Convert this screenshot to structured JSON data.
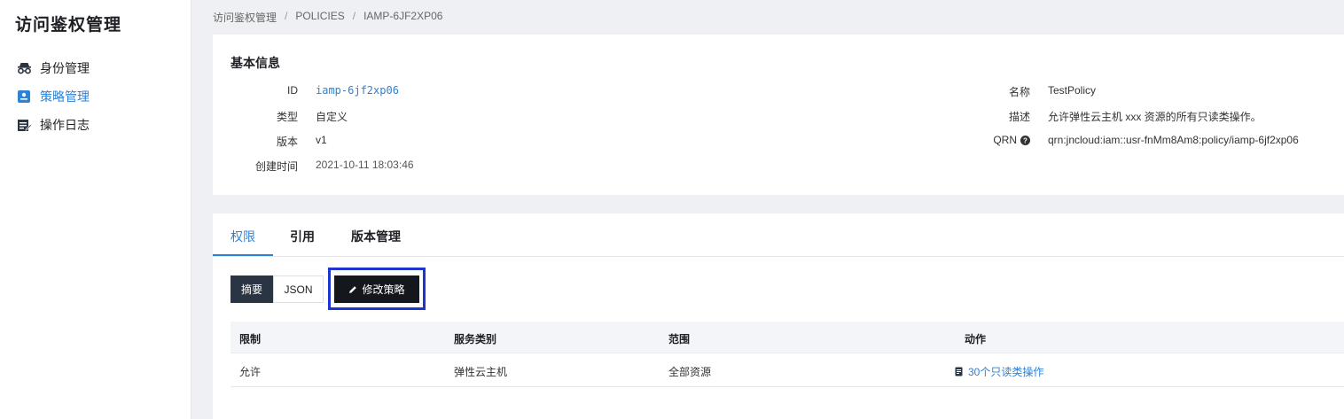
{
  "sidebar": {
    "title": "访问鉴权管理",
    "items": [
      {
        "label": "身份管理",
        "icon": "identity-icon"
      },
      {
        "label": "策略管理",
        "icon": "policy-icon"
      },
      {
        "label": "操作日志",
        "icon": "log-icon"
      }
    ]
  },
  "breadcrumb": [
    "访问鉴权管理",
    "POLICIES",
    "IAMP-6JF2XP06"
  ],
  "basic_info": {
    "title": "基本信息",
    "left": [
      {
        "label": "ID",
        "value": "iamp-6jf2xp06"
      },
      {
        "label": "类型",
        "value": "自定义"
      },
      {
        "label": "版本",
        "value": "v1"
      },
      {
        "label": "创建时间",
        "value": "2021-10-11 18:03:46"
      }
    ],
    "right": [
      {
        "label": "名称",
        "value": "TestPolicy"
      },
      {
        "label": "描述",
        "value": "允许弹性云主机 xxx 资源的所有只读类操作。"
      },
      {
        "label": "QRN",
        "value": "qrn:jncloud:iam::usr-fnMm8Am8:policy/iamp-6jf2xp06"
      }
    ]
  },
  "tabs": [
    "权限",
    "引用",
    "版本管理"
  ],
  "view_toggle": {
    "summary": "摘要",
    "json": "JSON"
  },
  "edit_button": "修改策略",
  "table": {
    "headers": [
      "限制",
      "服务类别",
      "范围",
      "动作"
    ],
    "rows": [
      {
        "effect": "允许",
        "service": "弹性云主机",
        "scope": "全部资源",
        "action": "30个只读类操作"
      }
    ]
  }
}
